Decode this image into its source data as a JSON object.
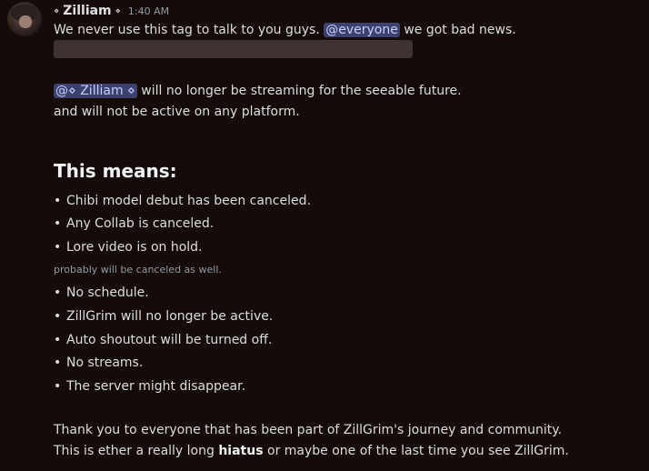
{
  "author": {
    "name": "Zilliam",
    "prefix_icon": "diamond-icon",
    "suffix_icon": "diamond-icon",
    "timestamp": "1:40 AM"
  },
  "message": {
    "line1_pre": "We never use this tag to talk to you guys.",
    "line1_mention": "@everyone",
    "line1_post": "we got bad news.",
    "user_mention": "@⋄ Zilliam ⋄",
    "line2_post": "will no longer be streaming for the seeable future.",
    "line3": "and will not be active on any platform.",
    "heading": "This means:",
    "bullets_a": [
      "Chibi model debut has been canceled.",
      "Any Collab is canceled.",
      "Lore video is on hold."
    ],
    "subtext": "probably will be canceled as well.",
    "bullets_b": [
      "No schedule.",
      "ZillGrim will no longer be active.",
      "Auto shoutout will be turned off.",
      "No streams.",
      "The server might disappear."
    ],
    "closing1": "Thank you to everyone that has been part of ZillGrim's journey and community.",
    "closing2_pre": "This is ether a really long",
    "closing2_bold": "hiatus",
    "closing2_post": "or maybe one of the last time you see ZillGrim."
  },
  "colors": {
    "background": "#150b09",
    "mention_bg": "#3c4270",
    "mention_text": "#c9cdfb",
    "spoiler": "#3e3233"
  }
}
